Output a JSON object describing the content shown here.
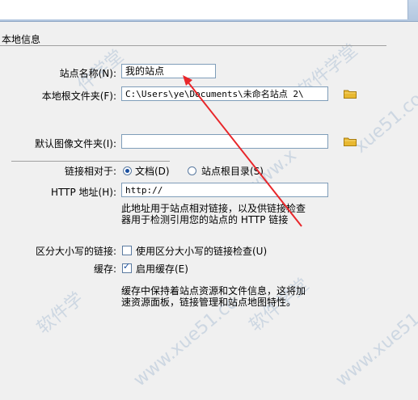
{
  "section": {
    "title": "本地信息"
  },
  "site_name": {
    "label": "站点名称(N):",
    "value": "我的站点"
  },
  "local_root": {
    "label": "本地根文件夹(F):",
    "value": "C:\\Users\\ye\\Documents\\未命名站点 2\\"
  },
  "default_images": {
    "label": "默认图像文件夹(I):",
    "value": ""
  },
  "links_relative": {
    "label": "链接相对于:",
    "options": [
      "文档(D)",
      "站点根目录(S)"
    ],
    "selected": "文档(D)"
  },
  "http_address": {
    "label": "HTTP 地址(H):",
    "value": "http://"
  },
  "http_note": [
    "此地址用于站点相对链接，以及供链接检查",
    "器用于检测引用您的站点的 HTTP 链接"
  ],
  "case_sensitive": {
    "label": "区分大小写的链接:",
    "checkbox_label": "使用区分大小写的链接检查(U)",
    "checked": false
  },
  "cache": {
    "label": "缓存:",
    "checkbox_label": "启用缓存(E)",
    "checked": true
  },
  "cache_note": [
    "缓存中保持着站点资源和文件信息，这将加",
    "速资源面板，链接管理和站点地图特性。"
  ],
  "colors": {
    "arrow": "#e8262a",
    "folder": "#e8b830",
    "field_border": "#7f9db9"
  },
  "icons": {
    "folder": "folder-icon"
  }
}
